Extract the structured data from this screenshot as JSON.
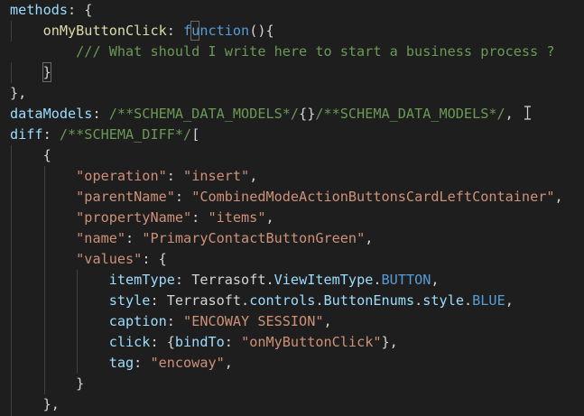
{
  "theme": {
    "background": "#1e1e1e",
    "colors": {
      "plain": "#d4d4d4",
      "keyword": "#569cd6",
      "function": "#dcdcaa",
      "property": "#9cdcfe",
      "string": "#ce9178",
      "comment": "#6a9955",
      "type": "#4ec9b0"
    }
  },
  "cursor_icon": "text-cursor-icon",
  "lines": [
    {
      "tokens": [
        [
          "methods",
          "property"
        ],
        [
          ": {",
          "plain"
        ]
      ]
    },
    {
      "tokens": [
        [
          "    ",
          "plain"
        ],
        [
          "onMyButtonClick",
          "function"
        ],
        [
          ": ",
          "plain"
        ],
        [
          "function",
          "keyword"
        ],
        [
          "(){",
          "plain"
        ]
      ]
    },
    {
      "tokens": [
        [
          "        ",
          "plain"
        ],
        [
          "/// What should I write here to start a business process ?",
          "comment"
        ]
      ],
      "active": true
    },
    {
      "tokens": [
        [
          "    ",
          "plain"
        ],
        [
          "}",
          "plain"
        ]
      ]
    },
    {
      "tokens": [
        [
          "},",
          "plain"
        ]
      ]
    },
    {
      "tokens": [
        [
          "dataModels",
          "property"
        ],
        [
          ": ",
          "plain"
        ],
        [
          "/**SCHEMA_DATA_MODELS*/",
          "comment"
        ],
        [
          "{}",
          "plain"
        ],
        [
          "/**SCHEMA_DATA_MODELS*/",
          "comment"
        ],
        [
          ",",
          "plain"
        ]
      ]
    },
    {
      "tokens": [
        [
          "diff",
          "property"
        ],
        [
          ": ",
          "plain"
        ],
        [
          "/**SCHEMA_DIFF*/",
          "comment"
        ],
        [
          "[",
          "plain"
        ]
      ]
    },
    {
      "tokens": [
        [
          "    ",
          "plain"
        ],
        [
          "{",
          "plain"
        ]
      ]
    },
    {
      "tokens": [
        [
          "        ",
          "plain"
        ],
        [
          "\"operation\"",
          "string"
        ],
        [
          ": ",
          "plain"
        ],
        [
          "\"insert\"",
          "string"
        ],
        [
          ",",
          "plain"
        ]
      ]
    },
    {
      "tokens": [
        [
          "        ",
          "plain"
        ],
        [
          "\"parentName\"",
          "string"
        ],
        [
          ": ",
          "plain"
        ],
        [
          "\"CombinedModeActionButtonsCardLeftContainer\"",
          "string"
        ],
        [
          ",",
          "plain"
        ]
      ]
    },
    {
      "tokens": [
        [
          "        ",
          "plain"
        ],
        [
          "\"propertyName\"",
          "string"
        ],
        [
          ": ",
          "plain"
        ],
        [
          "\"items\"",
          "string"
        ],
        [
          ",",
          "plain"
        ]
      ]
    },
    {
      "tokens": [
        [
          "        ",
          "plain"
        ],
        [
          "\"name\"",
          "string"
        ],
        [
          ": ",
          "plain"
        ],
        [
          "\"PrimaryContactButtonGreen\"",
          "string"
        ],
        [
          ",",
          "plain"
        ]
      ]
    },
    {
      "tokens": [
        [
          "        ",
          "plain"
        ],
        [
          "\"values\"",
          "string"
        ],
        [
          ": {",
          "plain"
        ]
      ]
    },
    {
      "tokens": [
        [
          "            ",
          "plain"
        ],
        [
          "itemType",
          "property"
        ],
        [
          ": ",
          "plain"
        ],
        [
          "Terrasoft",
          "plain"
        ],
        [
          ".",
          "plain"
        ],
        [
          "ViewItemType",
          "property"
        ],
        [
          ".",
          "plain"
        ],
        [
          "BUTTON",
          "keyword"
        ],
        [
          ",",
          "plain"
        ]
      ]
    },
    {
      "tokens": [
        [
          "            ",
          "plain"
        ],
        [
          "style",
          "property"
        ],
        [
          ": ",
          "plain"
        ],
        [
          "Terrasoft",
          "plain"
        ],
        [
          ".",
          "plain"
        ],
        [
          "controls",
          "property"
        ],
        [
          ".",
          "plain"
        ],
        [
          "ButtonEnums",
          "property"
        ],
        [
          ".",
          "plain"
        ],
        [
          "style",
          "property"
        ],
        [
          ".",
          "plain"
        ],
        [
          "BLUE",
          "keyword"
        ],
        [
          ",",
          "plain"
        ]
      ]
    },
    {
      "tokens": [
        [
          "            ",
          "plain"
        ],
        [
          "caption",
          "property"
        ],
        [
          ": ",
          "plain"
        ],
        [
          "\"ENCOWAY SESSION\"",
          "string"
        ],
        [
          ",",
          "plain"
        ]
      ]
    },
    {
      "tokens": [
        [
          "            ",
          "plain"
        ],
        [
          "click",
          "property"
        ],
        [
          ": {",
          "plain"
        ],
        [
          "bindTo",
          "property"
        ],
        [
          ": ",
          "plain"
        ],
        [
          "\"onMyButtonClick\"",
          "string"
        ],
        [
          "},",
          "plain"
        ]
      ]
    },
    {
      "tokens": [
        [
          "            ",
          "plain"
        ],
        [
          "tag",
          "property"
        ],
        [
          ": ",
          "plain"
        ],
        [
          "\"encoway\"",
          "string"
        ],
        [
          ",",
          "plain"
        ]
      ]
    },
    {
      "tokens": [
        [
          "        ",
          "plain"
        ],
        [
          "}",
          "plain"
        ]
      ]
    },
    {
      "tokens": [
        [
          "    ",
          "plain"
        ],
        [
          "},",
          "plain"
        ]
      ]
    },
    {
      "tokens": [
        [
          "    ",
          "plain"
        ],
        [
          "{",
          "plain"
        ]
      ]
    }
  ]
}
